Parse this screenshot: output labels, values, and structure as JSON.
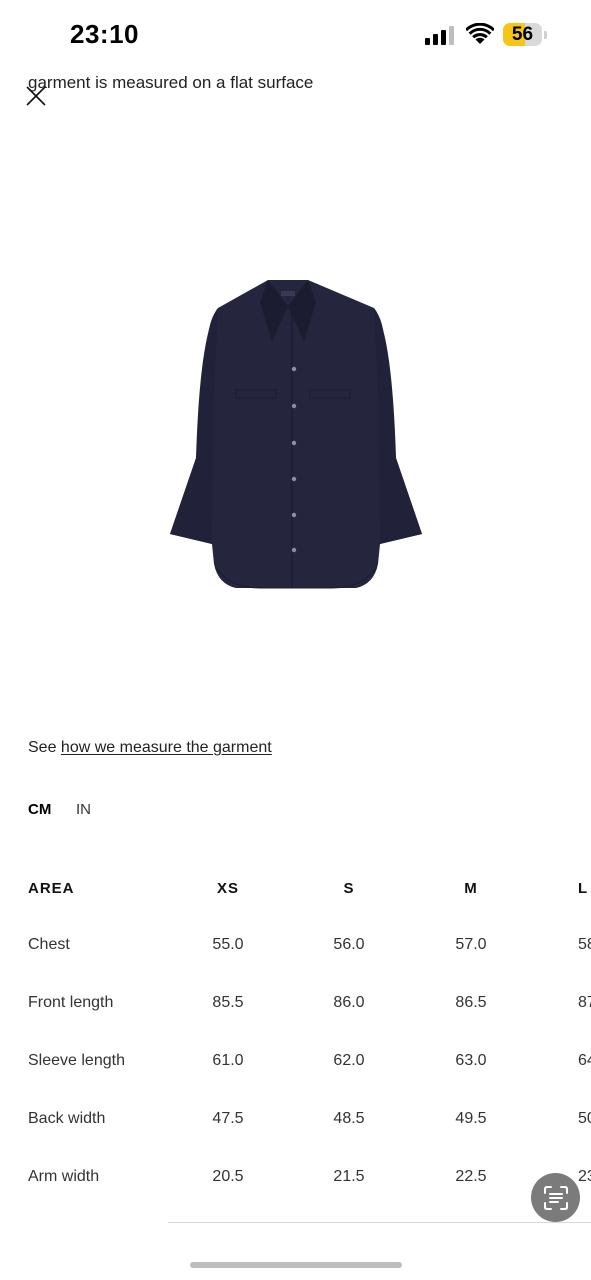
{
  "status_bar": {
    "time": "23:10",
    "battery_level": "56",
    "battery_fraction": 0.56,
    "battery_color": "#f5c518",
    "signal_icon": "cellular-signal-icon",
    "wifi_icon": "wifi-icon"
  },
  "header": {
    "clipped_caption": "garment is measured on a flat surface",
    "close_icon": "close-icon"
  },
  "product": {
    "image": "navy-shirt-image",
    "color": "#25253d"
  },
  "measure": {
    "prefix": "See ",
    "link_text": "how we measure the garment"
  },
  "units": {
    "cm": "CM",
    "in": "IN",
    "selected": "CM"
  },
  "table": {
    "headers": [
      "AREA",
      "XS",
      "S",
      "M",
      "L"
    ],
    "rows": [
      {
        "area": "Chest",
        "values": [
          "55.0",
          "56.0",
          "57.0",
          "58"
        ]
      },
      {
        "area": "Front length",
        "values": [
          "85.5",
          "86.0",
          "86.5",
          "87"
        ]
      },
      {
        "area": "Sleeve length",
        "values": [
          "61.0",
          "62.0",
          "63.0",
          "64"
        ]
      },
      {
        "area": "Back width",
        "values": [
          "47.5",
          "48.5",
          "49.5",
          "50"
        ]
      },
      {
        "area": "Arm width",
        "values": [
          "20.5",
          "21.5",
          "22.5",
          "23"
        ]
      }
    ]
  },
  "floating_button": {
    "icon": "text-scan-icon"
  }
}
